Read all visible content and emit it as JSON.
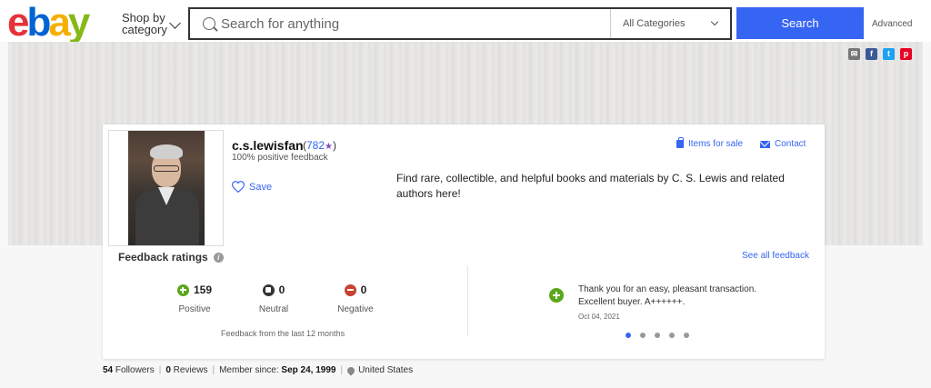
{
  "header": {
    "logo_letters": [
      "e",
      "b",
      "a",
      "y"
    ],
    "shop_by_line1": "Shop by",
    "shop_by_line2": "category",
    "search_placeholder": "Search for anything",
    "category_select": "All Categories",
    "search_button": "Search",
    "advanced_link": "Advanced"
  },
  "social": {
    "mail": "✉",
    "facebook": "f",
    "twitter": "t",
    "pinterest": "p"
  },
  "seller": {
    "username": "c.s.lewisfan",
    "score_open": "(",
    "score": "782",
    "score_close": ")",
    "star": "★",
    "positive_feedback": "100% positive feedback",
    "save_label": "Save",
    "items_for_sale": "Items for sale",
    "contact": "Contact",
    "description": "Find rare, collectible, and helpful books and materials by C. S. Lewis and related authors here!"
  },
  "feedback": {
    "title": "Feedback ratings",
    "info_glyph": "i",
    "see_all": "See all feedback",
    "positive_count": "159",
    "positive_label": "Positive",
    "neutral_count": "0",
    "neutral_label": "Neutral",
    "negative_count": "0",
    "negative_label": "Negative",
    "period": "Feedback from the last 12 months",
    "comment_line1": "Thank you for an easy, pleasant transaction.",
    "comment_line2": "Excellent buyer. A++++++.",
    "comment_date": "Oct 04, 2021",
    "pager_count": 5,
    "pager_active": 0
  },
  "footer": {
    "followers_count": "54",
    "followers_label": "Followers",
    "reviews_count": "0",
    "reviews_label": "Reviews",
    "member_since_label": "Member since:",
    "member_since_date": "Sep 24, 1999",
    "location": "United States",
    "separator": "|"
  },
  "colors": {
    "accent": "#3665f3",
    "positive": "#5ba71b",
    "negative": "#c7422f"
  }
}
